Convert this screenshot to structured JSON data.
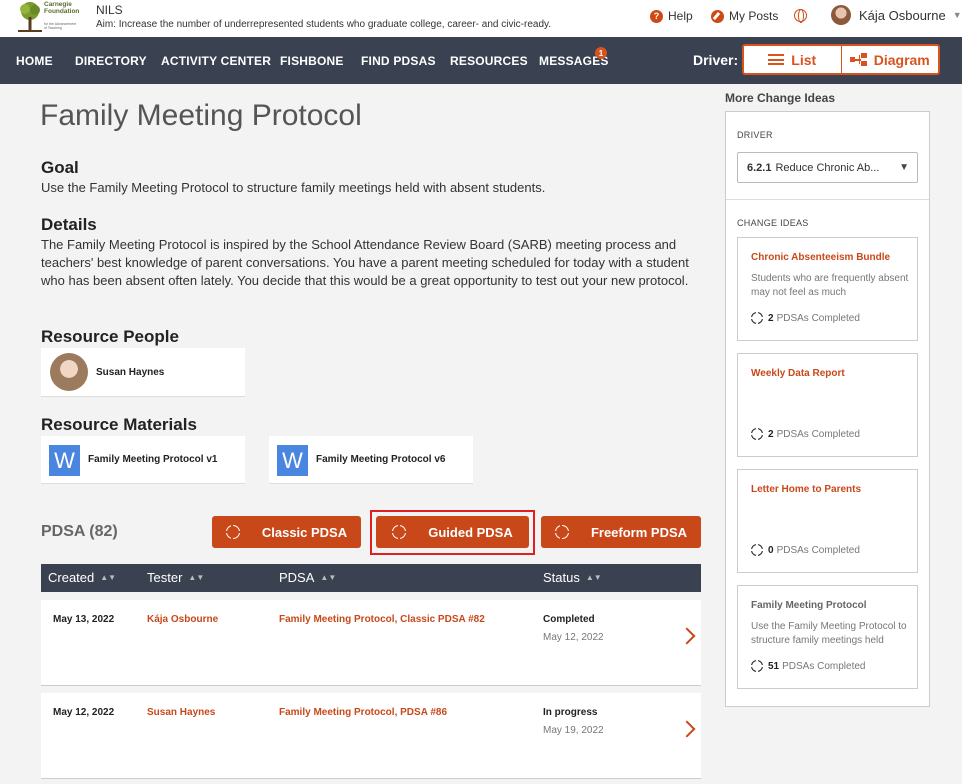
{
  "header": {
    "logo_text": "Carnegie Foundation",
    "logo_subtext": "for the Advancement of Teaching",
    "app_name": "NILS",
    "aim": "Aim:  Increase the number of underrepresented students who graduate college, career- and civic-ready.",
    "help_label": "Help",
    "my_posts_label": "My Posts",
    "user_name": "Kája Osbourne"
  },
  "nav": {
    "items": [
      "HOME",
      "DIRECTORY",
      "ACTIVITY CENTER",
      "FISHBONE",
      "FIND PDSAS",
      "RESOURCES",
      "MESSAGES"
    ],
    "messages_badge": "1",
    "driver_label": "Driver:",
    "list_label": "List",
    "diagram_label": "Diagram"
  },
  "main": {
    "title": "Family Meeting Protocol",
    "goal_heading": "Goal",
    "goal_text": "Use the Family Meeting Protocol to structure family meetings held with absent students.",
    "details_heading": "Details",
    "details_text": "The Family Meeting Protocol is inspired by the School Attendance Review Board (SARB) meeting process and teachers' best knowledge of parent conversations. You have a parent meeting scheduled for today with a student who has been absent often lately. You decide that this would be a great opportunity to test out your new protocol.",
    "resource_people_heading": "Resource People",
    "resource_people": [
      "Susan Haynes"
    ],
    "resource_materials_heading": "Resource Materials",
    "resource_materials": [
      "Family Meeting Protocol v1",
      "Family Meeting Protocol v6"
    ],
    "word_icon_letter": "W"
  },
  "pdsa": {
    "title": "PDSA (82)",
    "buttons": [
      "Classic PDSA",
      "Guided PDSA",
      "Freeform PDSA"
    ],
    "columns": [
      "Created",
      "Tester",
      "PDSA",
      "Status"
    ],
    "sort_glyph": "▲▼",
    "rows": [
      {
        "created": "May 13, 2022",
        "tester": "Kája Osbourne",
        "pdsa": "Family Meeting Protocol, Classic PDSA #82",
        "status": "Completed",
        "status_date": "May 12, 2022"
      },
      {
        "created": "May 12, 2022",
        "tester": "Susan Haynes",
        "pdsa": "Family Meeting Protocol, PDSA #86",
        "status": "In progress",
        "status_date": "May 19, 2022"
      }
    ]
  },
  "sidebar": {
    "title": "More Change Ideas",
    "driver_label": "DRIVER",
    "driver_code": "6.2.1",
    "driver_value": "Reduce Chronic Ab...",
    "change_ideas_label": "CHANGE IDEAS",
    "ideas": [
      {
        "title": "Chronic Absenteeism Bundle",
        "desc": "Students who are frequently absent may not feel as much",
        "count": "2",
        "count_label": "PDSAs Completed"
      },
      {
        "title": "Weekly Data Report",
        "desc": "",
        "count": "2",
        "count_label": "PDSAs Completed"
      },
      {
        "title": "Letter Home to Parents",
        "desc": "",
        "count": "0",
        "count_label": "PDSAs Completed"
      },
      {
        "title": "Family Meeting Protocol",
        "desc": "Use the Family Meeting Protocol to structure family meetings held",
        "count": "51",
        "count_label": "PDSAs Completed"
      }
    ]
  },
  "colors": {
    "accent": "#c9481a",
    "nav_bg": "#3a4151",
    "highlight_box": "#e02020"
  }
}
